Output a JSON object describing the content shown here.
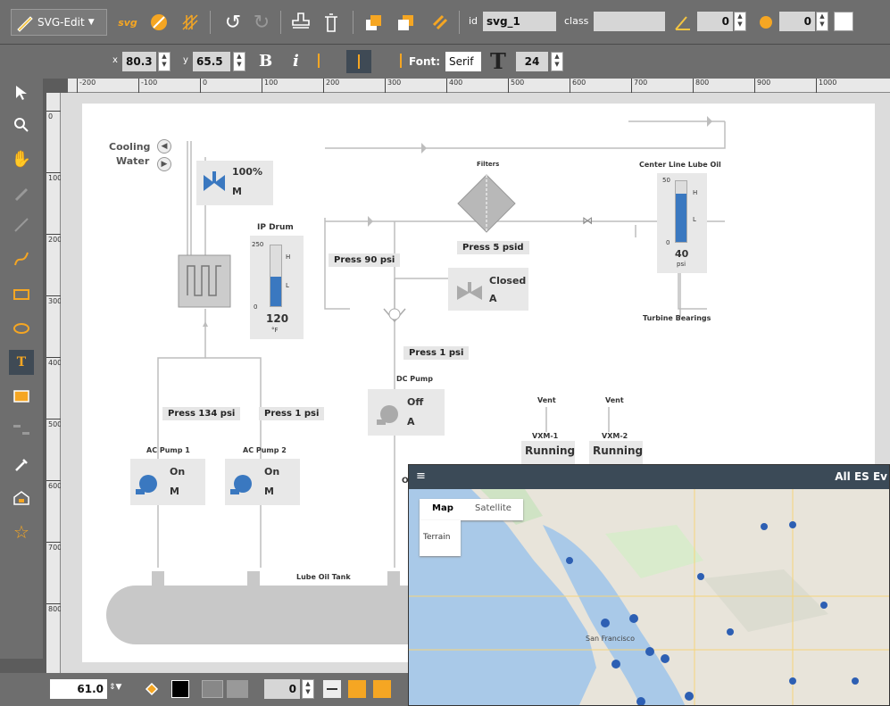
{
  "toolbar": {
    "app_menu": "SVG-Edit",
    "id_label": "id",
    "id_value": "svg_1",
    "class_label": "class",
    "class_value": "",
    "angle_value": "0",
    "blur_value": "0"
  },
  "text_toolbar": {
    "x_label": "x",
    "x_value": "80.3",
    "y_label": "y",
    "y_value": "65.5",
    "bold_label": "B",
    "italic_label": "i",
    "font_label": "Font:",
    "font_value": "Serif",
    "size_icon_label": "T",
    "size_value": "24"
  },
  "ruler": {
    "top_ticks": [
      "-200",
      "-100",
      "0",
      "100",
      "200",
      "300",
      "400",
      "500",
      "600",
      "700",
      "800",
      "900",
      "1000"
    ],
    "left_ticks": [
      "0",
      "100",
      "200",
      "300",
      "400",
      "500",
      "600",
      "700",
      "800"
    ]
  },
  "bottom_bar": {
    "zoom_value": "61.0",
    "stroke_width_value": "0"
  },
  "diagram": {
    "cooling_water_line1": "Cooling",
    "cooling_water_line2": "Water",
    "valve_pct": "100%",
    "valve_mode": "M",
    "ip_drum_title": "IP Drum",
    "ip_drum_max": "250",
    "ip_drum_min": "0",
    "ip_drum_h": "H",
    "ip_drum_l": "L",
    "ip_drum_value": "120",
    "ip_drum_unit": "°F",
    "press_90": "Press 90 psi",
    "filter_title": "Filters",
    "press_5": "Press 5 psid",
    "closed_valve_state": "Closed",
    "closed_valve_mode": "A",
    "lube_oil_title": "Center Line Lube Oil",
    "lube_oil_max": "50",
    "lube_oil_min": "0",
    "lube_oil_h": "H",
    "lube_oil_l": "L",
    "lube_oil_value": "40",
    "lube_oil_unit": "psi",
    "turbine_bearings": "Turbine Bearings",
    "press_1_mid": "Press 1 psi",
    "dc_pump_title": "DC Pump",
    "dc_pump_state": "Off",
    "dc_pump_mode": "A",
    "vent1": "Vent",
    "vent2": "Vent",
    "vxm1": "VXM-1",
    "vxm2": "VXM-2",
    "vxm1_state": "Running",
    "vxm2_state": "Running",
    "press_134": "Press 134 psi",
    "press_1_left": "Press 1 psi",
    "ac_pump1_title": "AC Pump 1",
    "ac_pump1_state": "On",
    "ac_pump1_mode": "M",
    "ac_pump2_title": "AC Pump 2",
    "ac_pump2_state": "On",
    "ac_pump2_mode": "M",
    "lube_oil_tank": "Lube Oil Tank",
    "partial_label": "O"
  },
  "map_window": {
    "title": "All ES Ev",
    "map_tab": "Map",
    "satellite_tab": "Satellite",
    "terrain_label": "Terrain",
    "city_label": "San Francisco"
  },
  "colors": {
    "accent_orange": "#f5a623",
    "pump_blue": "#3a78c0",
    "toolbar_grey": "#6e6e6e",
    "map_header": "#3b4a57",
    "pin_blue": "#2d5fb3"
  }
}
